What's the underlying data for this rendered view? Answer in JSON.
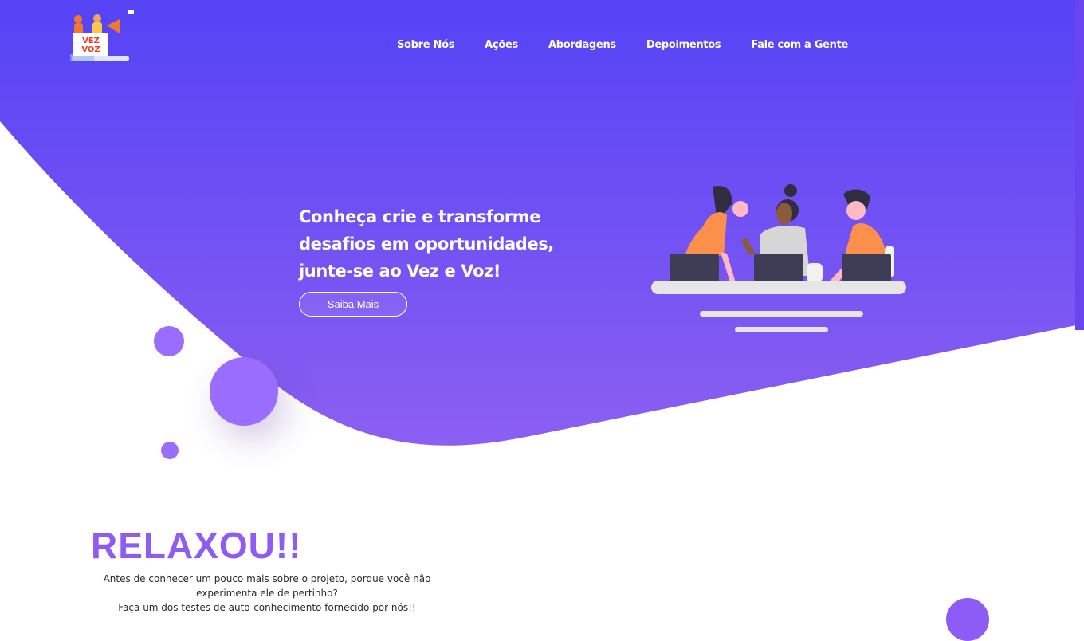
{
  "nav": {
    "items": [
      {
        "label": "Sobre Nós"
      },
      {
        "label": "Ações"
      },
      {
        "label": "Abordagens"
      },
      {
        "label": "Depoimentos"
      },
      {
        "label": "Fale com a Gente"
      }
    ]
  },
  "hero": {
    "title_line1": "Conheça crie e transforme",
    "title_line2": "desafios em oportunidades,",
    "title_line3": "junte-se ao Vez e Voz!",
    "button_label": "Saiba Mais"
  },
  "logo": {
    "text_top": "VEZ",
    "text_bottom": "VOZ"
  },
  "relax": {
    "title": "RELAXOU!!",
    "line1": "Antes de conhecer um pouco mais sobre o projeto, porque você não",
    "line2": "experimenta ele de pertinho?",
    "line3": "Faça um dos testes de auto-conhecimento fornecido por nós!!"
  },
  "colors": {
    "hero_top": "#5543f5",
    "hero_bottom": "#8c5ff2",
    "accent_purple": "#8e5cf2",
    "bubble": "#9b6dff",
    "illustration_orange": "#fb8f4c",
    "laptop": "#3f3d56"
  },
  "icons": {
    "logo": "vez-voz-logo-icon",
    "hero_illustration": "team-at-laptops-illustration-icon"
  }
}
